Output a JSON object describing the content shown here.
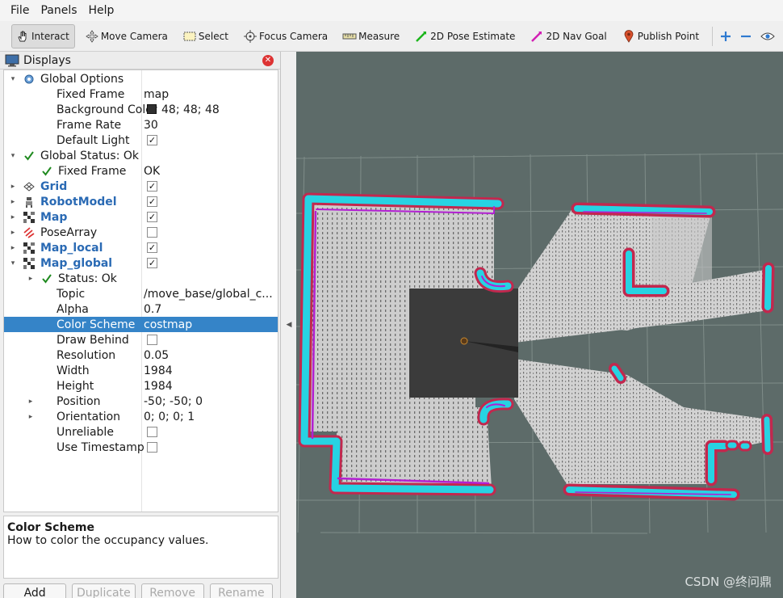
{
  "menu": [
    {
      "label": "File",
      "accel": "F"
    },
    {
      "label": "Panels",
      "accel": "P"
    },
    {
      "label": "Help",
      "accel": "H"
    }
  ],
  "toolbar": {
    "tools": [
      {
        "label": "Interact",
        "icon": "hand-icon",
        "active": true
      },
      {
        "label": "Move Camera",
        "icon": "move-camera-icon",
        "active": false
      },
      {
        "label": "Select",
        "icon": "select-icon",
        "active": false
      },
      {
        "label": "Focus Camera",
        "icon": "focus-camera-icon",
        "active": false
      },
      {
        "label": "Measure",
        "icon": "ruler-icon",
        "active": false
      },
      {
        "label": "2D Pose Estimate",
        "icon": "pose-estimate-icon",
        "active": false
      },
      {
        "label": "2D Nav Goal",
        "icon": "nav-goal-icon",
        "active": false
      },
      {
        "label": "Publish Point",
        "icon": "map-pin-icon",
        "active": false
      }
    ],
    "extra_icons": [
      "plus-icon",
      "minus-icon",
      "eye-icon"
    ]
  },
  "displays": {
    "title": "Displays",
    "rows": [
      {
        "label": "Global Options",
        "value": "",
        "arrow": "down",
        "icon": "gear-icon"
      },
      {
        "label": "Fixed Frame",
        "value": "map"
      },
      {
        "label": "Background Color",
        "value": "48; 48; 48",
        "swatch": true
      },
      {
        "label": "Frame Rate",
        "value": "30"
      },
      {
        "label": "Default Light",
        "check": true
      },
      {
        "label": "Global Status: Ok",
        "arrow": "down",
        "icon": "check-icon"
      },
      {
        "label": "Fixed Frame",
        "value": "OK",
        "icon": "check-icon"
      },
      {
        "label": "Grid",
        "bold": true,
        "arrow": "right",
        "icon": "grid-icon",
        "check": true
      },
      {
        "label": "RobotModel",
        "bold": true,
        "arrow": "right",
        "icon": "robot-icon",
        "check": true
      },
      {
        "label": "Map",
        "bold": true,
        "arrow": "right",
        "icon": "map-icon",
        "check": true
      },
      {
        "label": "PoseArray",
        "arrow": "right",
        "icon": "pose-array-icon",
        "check": false
      },
      {
        "label": "Map_local",
        "bold": true,
        "arrow": "right",
        "icon": "map-icon",
        "check": true
      },
      {
        "label": "Map_global",
        "bold": true,
        "arrow": "down",
        "icon": "map-icon",
        "check": true
      },
      {
        "label": "Status: Ok",
        "arrow": "right",
        "icon": "check-icon"
      },
      {
        "label": "Topic",
        "value": "/move_base/global_c..."
      },
      {
        "label": "Alpha",
        "value": "0.7"
      },
      {
        "label": "Color Scheme",
        "value": "costmap",
        "selected": true
      },
      {
        "label": "Draw Behind",
        "check": false
      },
      {
        "label": "Resolution",
        "value": "0.05"
      },
      {
        "label": "Width",
        "value": "1984"
      },
      {
        "label": "Height",
        "value": "1984"
      },
      {
        "label": "Position",
        "value": "-50; -50; 0",
        "arrow": "right"
      },
      {
        "label": "Orientation",
        "value": "0; 0; 0; 1",
        "arrow": "right"
      },
      {
        "label": "Unreliable",
        "check": false
      },
      {
        "label": "Use Timestamp",
        "check": false
      }
    ],
    "description": {
      "title": "Color Scheme",
      "text": "How to color the occupancy values."
    },
    "buttons": [
      {
        "label": "Add",
        "enabled": true
      },
      {
        "label": "Duplicate",
        "enabled": false
      },
      {
        "label": "Remove",
        "enabled": false
      },
      {
        "label": "Rename",
        "enabled": false
      }
    ]
  },
  "watermark": "CSDN @终问鼎",
  "colors": {
    "viewport_bg": "#5d6b69",
    "costmap_cyan": "#27d3e3",
    "costmap_magenta": "#b21fd2",
    "costmap_red": "#c2284e",
    "free_space": "#cfcfcf",
    "selection": "#3584c8"
  }
}
